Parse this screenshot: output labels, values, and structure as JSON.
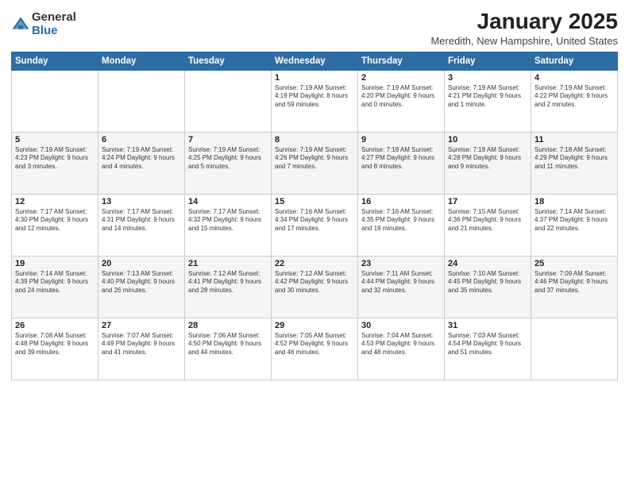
{
  "header": {
    "logo_general": "General",
    "logo_blue": "Blue",
    "month_title": "January 2025",
    "location": "Meredith, New Hampshire, United States"
  },
  "days_of_week": [
    "Sunday",
    "Monday",
    "Tuesday",
    "Wednesday",
    "Thursday",
    "Friday",
    "Saturday"
  ],
  "weeks": [
    [
      {
        "num": "",
        "info": ""
      },
      {
        "num": "",
        "info": ""
      },
      {
        "num": "",
        "info": ""
      },
      {
        "num": "1",
        "info": "Sunrise: 7:19 AM\nSunset: 4:19 PM\nDaylight: 8 hours and 59 minutes."
      },
      {
        "num": "2",
        "info": "Sunrise: 7:19 AM\nSunset: 4:20 PM\nDaylight: 9 hours and 0 minutes."
      },
      {
        "num": "3",
        "info": "Sunrise: 7:19 AM\nSunset: 4:21 PM\nDaylight: 9 hours and 1 minute."
      },
      {
        "num": "4",
        "info": "Sunrise: 7:19 AM\nSunset: 4:22 PM\nDaylight: 9 hours and 2 minutes."
      }
    ],
    [
      {
        "num": "5",
        "info": "Sunrise: 7:19 AM\nSunset: 4:23 PM\nDaylight: 9 hours and 3 minutes."
      },
      {
        "num": "6",
        "info": "Sunrise: 7:19 AM\nSunset: 4:24 PM\nDaylight: 9 hours and 4 minutes."
      },
      {
        "num": "7",
        "info": "Sunrise: 7:19 AM\nSunset: 4:25 PM\nDaylight: 9 hours and 5 minutes."
      },
      {
        "num": "8",
        "info": "Sunrise: 7:19 AM\nSunset: 4:26 PM\nDaylight: 9 hours and 7 minutes."
      },
      {
        "num": "9",
        "info": "Sunrise: 7:18 AM\nSunset: 4:27 PM\nDaylight: 9 hours and 8 minutes."
      },
      {
        "num": "10",
        "info": "Sunrise: 7:18 AM\nSunset: 4:28 PM\nDaylight: 9 hours and 9 minutes."
      },
      {
        "num": "11",
        "info": "Sunrise: 7:18 AM\nSunset: 4:29 PM\nDaylight: 9 hours and 11 minutes."
      }
    ],
    [
      {
        "num": "12",
        "info": "Sunrise: 7:17 AM\nSunset: 4:30 PM\nDaylight: 9 hours and 12 minutes."
      },
      {
        "num": "13",
        "info": "Sunrise: 7:17 AM\nSunset: 4:31 PM\nDaylight: 9 hours and 14 minutes."
      },
      {
        "num": "14",
        "info": "Sunrise: 7:17 AM\nSunset: 4:32 PM\nDaylight: 9 hours and 15 minutes."
      },
      {
        "num": "15",
        "info": "Sunrise: 7:16 AM\nSunset: 4:34 PM\nDaylight: 9 hours and 17 minutes."
      },
      {
        "num": "16",
        "info": "Sunrise: 7:16 AM\nSunset: 4:35 PM\nDaylight: 9 hours and 19 minutes."
      },
      {
        "num": "17",
        "info": "Sunrise: 7:15 AM\nSunset: 4:36 PM\nDaylight: 9 hours and 21 minutes."
      },
      {
        "num": "18",
        "info": "Sunrise: 7:14 AM\nSunset: 4:37 PM\nDaylight: 9 hours and 22 minutes."
      }
    ],
    [
      {
        "num": "19",
        "info": "Sunrise: 7:14 AM\nSunset: 4:39 PM\nDaylight: 9 hours and 24 minutes."
      },
      {
        "num": "20",
        "info": "Sunrise: 7:13 AM\nSunset: 4:40 PM\nDaylight: 9 hours and 26 minutes."
      },
      {
        "num": "21",
        "info": "Sunrise: 7:12 AM\nSunset: 4:41 PM\nDaylight: 9 hours and 28 minutes."
      },
      {
        "num": "22",
        "info": "Sunrise: 7:12 AM\nSunset: 4:42 PM\nDaylight: 9 hours and 30 minutes."
      },
      {
        "num": "23",
        "info": "Sunrise: 7:11 AM\nSunset: 4:44 PM\nDaylight: 9 hours and 32 minutes."
      },
      {
        "num": "24",
        "info": "Sunrise: 7:10 AM\nSunset: 4:45 PM\nDaylight: 9 hours and 35 minutes."
      },
      {
        "num": "25",
        "info": "Sunrise: 7:09 AM\nSunset: 4:46 PM\nDaylight: 9 hours and 37 minutes."
      }
    ],
    [
      {
        "num": "26",
        "info": "Sunrise: 7:08 AM\nSunset: 4:48 PM\nDaylight: 9 hours and 39 minutes."
      },
      {
        "num": "27",
        "info": "Sunrise: 7:07 AM\nSunset: 4:49 PM\nDaylight: 9 hours and 41 minutes."
      },
      {
        "num": "28",
        "info": "Sunrise: 7:06 AM\nSunset: 4:50 PM\nDaylight: 9 hours and 44 minutes."
      },
      {
        "num": "29",
        "info": "Sunrise: 7:05 AM\nSunset: 4:52 PM\nDaylight: 9 hours and 46 minutes."
      },
      {
        "num": "30",
        "info": "Sunrise: 7:04 AM\nSunset: 4:53 PM\nDaylight: 9 hours and 48 minutes."
      },
      {
        "num": "31",
        "info": "Sunrise: 7:03 AM\nSunset: 4:54 PM\nDaylight: 9 hours and 51 minutes."
      },
      {
        "num": "",
        "info": ""
      }
    ]
  ]
}
